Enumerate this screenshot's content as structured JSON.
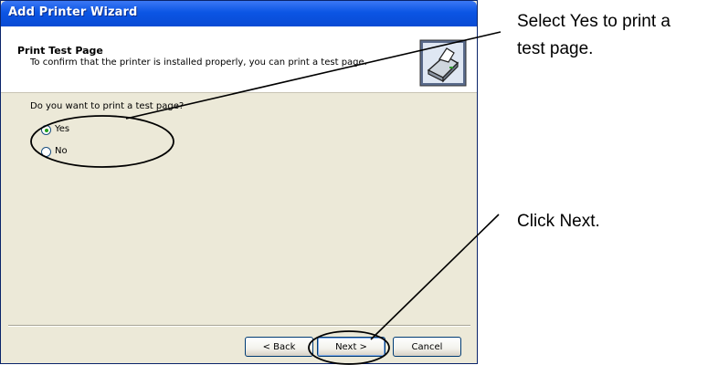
{
  "window": {
    "title": "Add Printer Wizard"
  },
  "header": {
    "title": "Print Test Page",
    "subtitle": "To confirm that the printer is installed properly, you can print a test page."
  },
  "icons": {
    "header": "printer-icon",
    "radio": "radio-button-icon"
  },
  "question": {
    "text": "Do you want to print a test page?"
  },
  "options": [
    {
      "label": "Yes",
      "selected": true
    },
    {
      "label": "No",
      "selected": false
    }
  ],
  "buttons": {
    "back": "< Back",
    "next": "Next >",
    "cancel": "Cancel"
  },
  "callouts": {
    "select_yes_line1": "Select Yes to print a",
    "select_yes_line2": "test page.",
    "click_next": "Click Next."
  },
  "colors": {
    "titlebar": "#0b55e4",
    "dialog_bg": "#ece9d8",
    "radio_dot": "#21a121"
  }
}
